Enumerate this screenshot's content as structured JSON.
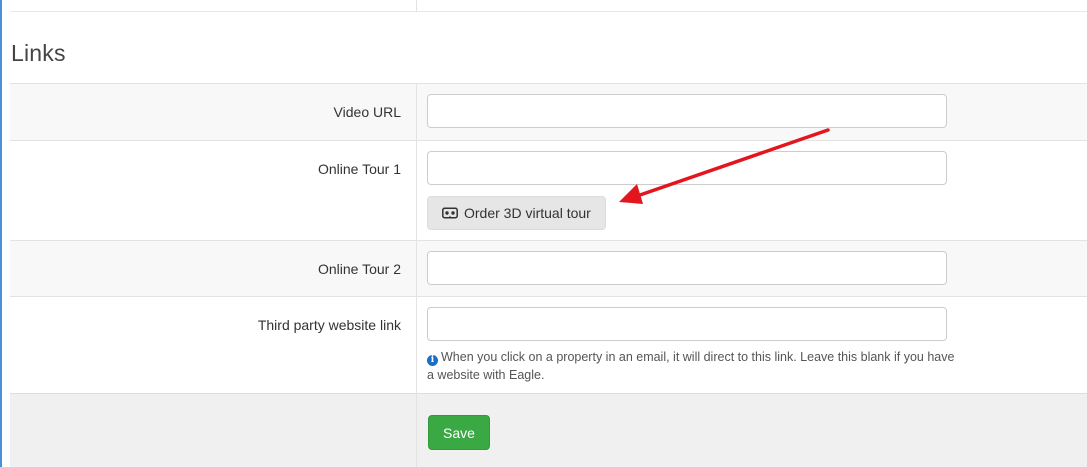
{
  "section": {
    "title": "Links"
  },
  "fields": {
    "video_url": {
      "label": "Video URL",
      "value": ""
    },
    "online_tour_1": {
      "label": "Online Tour 1",
      "value": "",
      "order_button_label": "Order 3D virtual tour"
    },
    "online_tour_2": {
      "label": "Online Tour 2",
      "value": ""
    },
    "third_party_link": {
      "label": "Third party website link",
      "value": "",
      "help_text": "When you click on a property in an email, it will direct to this link. Leave this blank if you have a website with Eagle."
    }
  },
  "footer": {
    "save_label": "Save"
  },
  "colors": {
    "accent_arrow": "#e3161d",
    "save_button": "#3aa843",
    "info_icon": "#1a6fc4"
  }
}
